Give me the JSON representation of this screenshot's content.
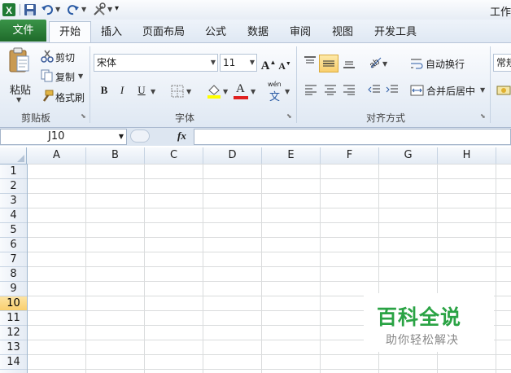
{
  "qat": {
    "title": "工作"
  },
  "tabs": [
    {
      "label": "文件"
    },
    {
      "label": "开始"
    },
    {
      "label": "插入"
    },
    {
      "label": "页面布局"
    },
    {
      "label": "公式"
    },
    {
      "label": "数据"
    },
    {
      "label": "审阅"
    },
    {
      "label": "视图"
    },
    {
      "label": "开发工具"
    }
  ],
  "clipboard": {
    "paste": "粘贴",
    "cut": "剪切",
    "copy": "复制",
    "format_painter": "格式刷",
    "label": "剪贴板"
  },
  "font": {
    "name": "宋体",
    "size": "11",
    "bold": "B",
    "italic": "I",
    "underline": "U",
    "label": "字体",
    "font_color_glyph": "A",
    "wen": "wén",
    "wen_char": "文"
  },
  "alignment": {
    "wrap": "自动换行",
    "merge": "合并后居中",
    "label": "对齐方式"
  },
  "number": {
    "format": "常规"
  },
  "formula_bar": {
    "cell_ref": "J10",
    "fx": "fx"
  },
  "columns": [
    "A",
    "B",
    "C",
    "D",
    "E",
    "F",
    "G",
    "H"
  ],
  "rows": [
    "1",
    "2",
    "3",
    "4",
    "5",
    "6",
    "7",
    "8",
    "9",
    "10",
    "11",
    "12",
    "13",
    "14"
  ],
  "active_row": "10",
  "watermark": {
    "title": "百科全说",
    "subtitle": "助你轻松解决"
  },
  "colors": {
    "file_tab": "#2a7e37",
    "active_row": "#f9d77e",
    "watermark": "#2aa344"
  }
}
